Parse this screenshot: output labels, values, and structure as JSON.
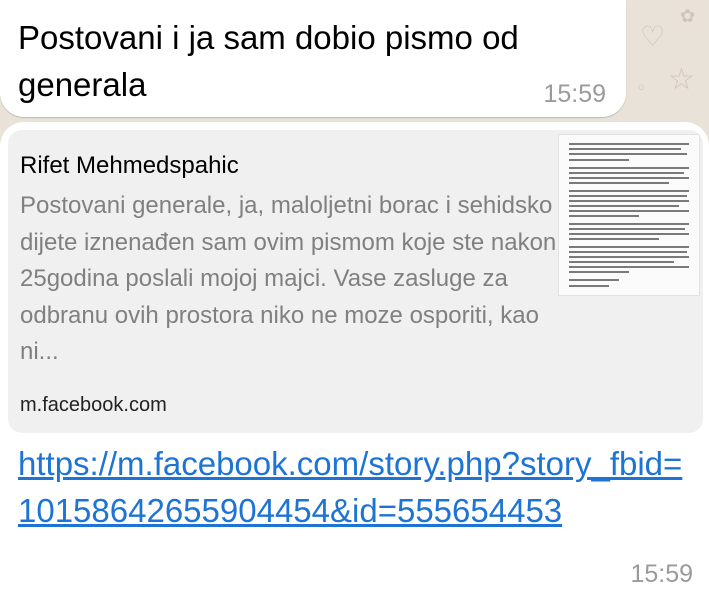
{
  "messages": [
    {
      "text": "Postovani i ja sam dobio pismo od generala",
      "time": "15:59"
    },
    {
      "preview": {
        "title": "Rifet Mehmedspahic",
        "description": "Postovani generale, ja, maloljetni borac i sehidsko dijete iznenađen sam ovim pismom koje ste nakon 25godina poslali mojoj majci. Vase zasluge za odbranu ovih prostora niko ne moze osporiti, kao ni...",
        "domain": "m.facebook.com",
        "thumbnail_icon": "document-thumbnail"
      },
      "link": "https://m.facebook.com/story.php?story_fbid=10158642655904454&id=555654453",
      "time": "15:59"
    }
  ],
  "colors": {
    "wallpaper": "#e9e2d8",
    "bubble": "#ffffff",
    "preview_bg": "#f0f0f0",
    "link": "#1d74d4",
    "timestamp": "#9a9a9a"
  }
}
